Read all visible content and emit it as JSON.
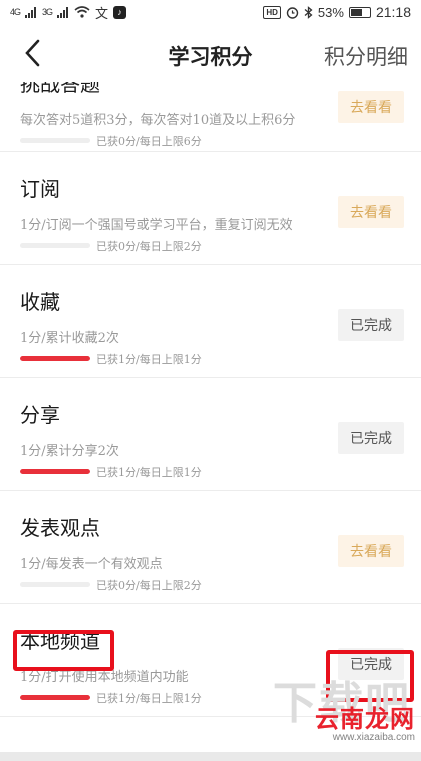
{
  "status_bar": {
    "signal_left": "4G",
    "signal_right": "3G",
    "hd_badge": "HD",
    "battery_percent": "53%",
    "time": "21:18"
  },
  "header": {
    "title": "学习积分",
    "detail_link": "积分明细"
  },
  "items": [
    {
      "title": "挑战答题",
      "desc": "每次答对5道积3分，每次答对10道及以上积6分",
      "progress_text": "已获0分/每日上限6分",
      "progress_fraction": 0,
      "action": "去看看",
      "action_state": "go"
    },
    {
      "title": "订阅",
      "desc": "1分/订阅一个强国号或学习平台，重复订阅无效",
      "progress_text": "已获0分/每日上限2分",
      "progress_fraction": 0,
      "action": "去看看",
      "action_state": "go"
    },
    {
      "title": "收藏",
      "desc": "1分/累计收藏2次",
      "progress_text": "已获1分/每日上限1分",
      "progress_fraction": 1,
      "action": "已完成",
      "action_state": "done"
    },
    {
      "title": "分享",
      "desc": "1分/累计分享2次",
      "progress_text": "已获1分/每日上限1分",
      "progress_fraction": 1,
      "action": "已完成",
      "action_state": "done"
    },
    {
      "title": "发表观点",
      "desc": "1分/每发表一个有效观点",
      "progress_text": "已获0分/每日上限2分",
      "progress_fraction": 0,
      "action": "去看看",
      "action_state": "go"
    },
    {
      "title": "本地频道",
      "desc": "1分/打开使用本地频道内功能",
      "progress_text": "已获1分/每日上限1分",
      "progress_fraction": 1,
      "action": "已完成",
      "action_state": "done"
    }
  ],
  "watermark": {
    "main": "云南龙网",
    "url": "www.xiazaiba.com",
    "back": "下载吧"
  },
  "colors": {
    "accent_red": "#e8303a",
    "highlight_red": "#e8101c",
    "go_button_bg": "#fdf3e6",
    "go_button_text": "#d9a95a",
    "done_button_bg": "#f2f2f2"
  },
  "icons": {
    "back": "chevron-left-icon",
    "wifi": "wifi-icon",
    "alarm": "alarm-icon",
    "bluetooth": "bluetooth-icon",
    "battery": "battery-icon"
  }
}
